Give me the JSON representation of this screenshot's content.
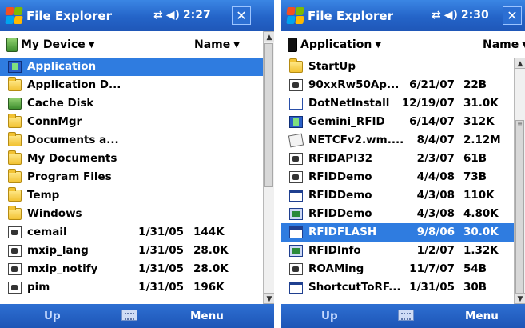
{
  "left": {
    "title": "File Explorer",
    "time": "2:27",
    "folder": "My Device",
    "sort": "Name",
    "soft_left": "Up",
    "soft_right": "Menu",
    "items": [
      {
        "icon": "application-folder-icon",
        "name": "Application",
        "date": "",
        "size": "",
        "selected": true
      },
      {
        "icon": "folder-icon",
        "name": "Application D...",
        "date": "",
        "size": ""
      },
      {
        "icon": "storage-card-icon",
        "name": "Cache Disk",
        "date": "",
        "size": ""
      },
      {
        "icon": "folder-icon",
        "name": "ConnMgr",
        "date": "",
        "size": ""
      },
      {
        "icon": "folder-icon",
        "name": "Documents a...",
        "date": "",
        "size": ""
      },
      {
        "icon": "folder-icon",
        "name": "My Documents",
        "date": "",
        "size": ""
      },
      {
        "icon": "folder-icon",
        "name": "Program Files",
        "date": "",
        "size": ""
      },
      {
        "icon": "folder-icon",
        "name": "Temp",
        "date": "",
        "size": ""
      },
      {
        "icon": "folder-icon",
        "name": "Windows",
        "date": "",
        "size": ""
      },
      {
        "icon": "file-icon",
        "name": "cemail",
        "date": "1/31/05",
        "size": "144K"
      },
      {
        "icon": "file-icon",
        "name": "mxip_lang",
        "date": "1/31/05",
        "size": "28.0K"
      },
      {
        "icon": "file-icon",
        "name": "mxip_notify",
        "date": "1/31/05",
        "size": "28.0K"
      },
      {
        "icon": "file-icon",
        "name": "pim",
        "date": "1/31/05",
        "size": "196K"
      }
    ]
  },
  "right": {
    "title": "File Explorer",
    "time": "2:30",
    "folder": "Application",
    "sort": "Name",
    "soft_left": "Up",
    "soft_right": "Menu",
    "items": [
      {
        "icon": "folder-icon",
        "name": "StartUp",
        "date": "",
        "size": ""
      },
      {
        "icon": "file-icon",
        "name": "90xxRw50Ap...",
        "date": "6/21/07",
        "size": "22B"
      },
      {
        "icon": "blank-file-icon",
        "name": "DotNetInstall",
        "date": "12/19/07",
        "size": "31.0K"
      },
      {
        "icon": "gemini-app-icon",
        "name": "Gemini_RFID",
        "date": "6/14/07",
        "size": "312K"
      },
      {
        "icon": "cab-file-icon",
        "name": "NETCFv2.wm....",
        "date": "8/4/07",
        "size": "2.12M"
      },
      {
        "icon": "file-icon",
        "name": "RFIDAPI32",
        "date": "2/3/07",
        "size": "61B"
      },
      {
        "icon": "file-icon",
        "name": "RFIDDemo",
        "date": "4/4/08",
        "size": "73B"
      },
      {
        "icon": "window-app-icon",
        "name": "RFIDDemo",
        "date": "4/3/08",
        "size": "110K"
      },
      {
        "icon": "application-icon",
        "name": "RFIDDemo",
        "date": "4/3/08",
        "size": "4.80K"
      },
      {
        "icon": "window-app-icon",
        "name": "RFIDFLASH",
        "date": "9/8/06",
        "size": "30.0K",
        "selected": true
      },
      {
        "icon": "application-icon",
        "name": "RFIDInfo",
        "date": "1/2/07",
        "size": "1.32K"
      },
      {
        "icon": "file-icon",
        "name": "ROAMing",
        "date": "11/7/07",
        "size": "54B"
      },
      {
        "icon": "window-app-icon",
        "name": "ShortcutToRF...",
        "date": "1/31/05",
        "size": "30B"
      }
    ]
  },
  "colors": {
    "titlebar": "#2464c8",
    "selection": "#2f7ce0",
    "softkey_bar": "#1d55b6"
  }
}
